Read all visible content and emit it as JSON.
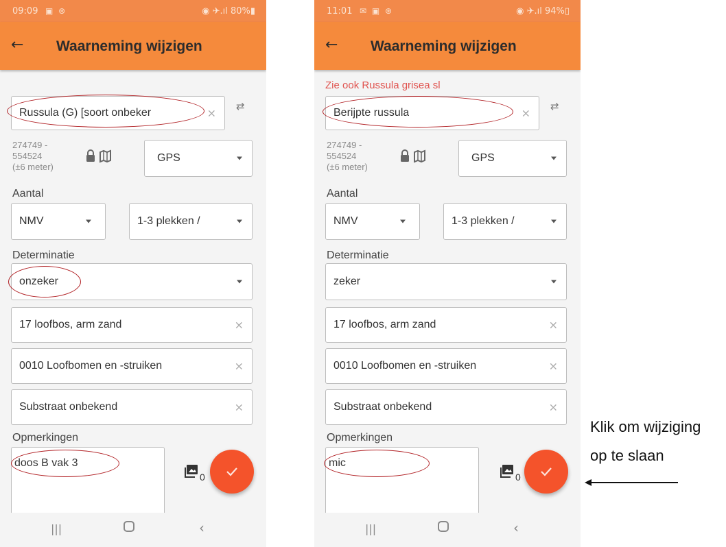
{
  "screens": [
    {
      "status": {
        "time": "09:09",
        "icons": "▣ ⊛",
        "right": "◉ ✈.ıl 80%▮"
      },
      "title": "Waarneming wijzigen",
      "warning": "",
      "species": "Russula (G) [soort onbeker",
      "coords": {
        "line1": "274749 -",
        "line2": "554524",
        "line3": "(±6 meter)"
      },
      "location_method": "GPS",
      "aantal_label": "Aantal",
      "count_type": "NMV",
      "count_value": "1-3 plekken /",
      "determinatie_label": "Determinatie",
      "determination": "onzeker",
      "habitat": "17 loofbos, arm zand",
      "vegetation": "0010 Loofbomen en -struiken",
      "substrate": "Substraat onbekend",
      "opmerkingen_label": "Opmerkingen",
      "remarks": "doos B vak 3",
      "photo_count": "0"
    },
    {
      "status": {
        "time": "11:01",
        "icons": "✉ ▣ ⊛",
        "right": "◉ ✈.ıl 94%▯"
      },
      "title": "Waarneming wijzigen",
      "warning": "Zie ook Russula grisea sl",
      "species": "Berijpte russula",
      "coords": {
        "line1": "274749 -",
        "line2": "554524",
        "line3": "(±6 meter)"
      },
      "location_method": "GPS",
      "aantal_label": "Aantal",
      "count_type": "NMV",
      "count_value": "1-3 plekken /",
      "determinatie_label": "Determinatie",
      "determination": "zeker",
      "habitat": "17 loofbos, arm zand",
      "vegetation": "0010 Loofbomen en -struiken",
      "substrate": "Substraat onbekend",
      "opmerkingen_label": "Opmerkingen",
      "remarks": "mic",
      "photo_count": "0"
    }
  ],
  "caption": {
    "line1": "Klik om wijziging",
    "line2": "op te slaan"
  },
  "colors": {
    "appbar": "#f58a3c",
    "fab": "#f4532b",
    "annotation": "#b01e22",
    "warning": "#e0534f"
  }
}
